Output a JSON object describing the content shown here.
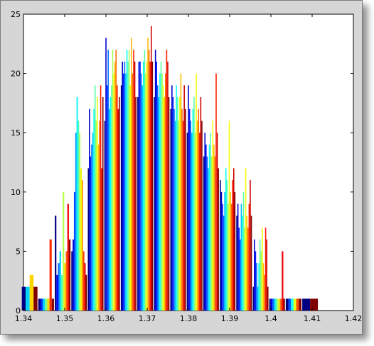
{
  "chart_data": {
    "type": "bar",
    "subtype": "histogram",
    "title": "",
    "xlabel": "",
    "ylabel": "",
    "xlim": [
      1.34,
      1.42
    ],
    "ylim": [
      0,
      25
    ],
    "xticks": [
      "1.34",
      "1.35",
      "1.36",
      "1.37",
      "1.38",
      "1.39",
      "1.4",
      "1.41",
      "1.42"
    ],
    "yticks": [
      "0",
      "5",
      "10",
      "15",
      "20",
      "25"
    ],
    "grid": false,
    "colormap": "jet",
    "colors": [
      "#00008f",
      "#0000ff",
      "#0080ff",
      "#00ffff",
      "#80ff80",
      "#ffff00",
      "#ff8000",
      "#ff0000",
      "#800000"
    ],
    "group_width": 0.0038,
    "groups": [
      {
        "x": 1.3415,
        "values": [
          2,
          2,
          3,
          2
        ]
      },
      {
        "x": 1.3455,
        "values": [
          1,
          1,
          1,
          1,
          1,
          6,
          1
        ]
      },
      {
        "x": 1.3495,
        "values": [
          8,
          3,
          4,
          5,
          3,
          10,
          4,
          5,
          9,
          6
        ]
      },
      {
        "x": 1.3535,
        "values": [
          5,
          6,
          10,
          15,
          18,
          16,
          15,
          12,
          11,
          5,
          4,
          3
        ]
      },
      {
        "x": 1.3575,
        "values": [
          12,
          17,
          13,
          14,
          15,
          17,
          19,
          16,
          18,
          14,
          16,
          19,
          12,
          18
        ]
      },
      {
        "x": 1.3615,
        "values": [
          16,
          23,
          19,
          22,
          17,
          18,
          19,
          22,
          20,
          21,
          22,
          19,
          17,
          18
        ]
      },
      {
        "x": 1.3655,
        "values": [
          19,
          21,
          20,
          21,
          20,
          22,
          21,
          22,
          19,
          23,
          20,
          22,
          21,
          18
        ]
      },
      {
        "x": 1.3695,
        "values": [
          18,
          21,
          21,
          20,
          19,
          21,
          22,
          20,
          21,
          23,
          22,
          21,
          24,
          21
        ]
      },
      {
        "x": 1.3735,
        "values": [
          18,
          22,
          21,
          19,
          18,
          20,
          21,
          20,
          19,
          18,
          20,
          22,
          21,
          18
        ]
      },
      {
        "x": 1.3775,
        "values": [
          17,
          19,
          18,
          17,
          16,
          19,
          18,
          16,
          18,
          20,
          17,
          16,
          19,
          17
        ]
      },
      {
        "x": 1.3815,
        "values": [
          15,
          19,
          17,
          16,
          15,
          17,
          18,
          15,
          20,
          16,
          17,
          15,
          18,
          16
        ]
      },
      {
        "x": 1.3855,
        "values": [
          13,
          15,
          14,
          13,
          12,
          14,
          15,
          13,
          16,
          14,
          13,
          20,
          15,
          12
        ]
      },
      {
        "x": 1.3895,
        "values": [
          11,
          10,
          9,
          8,
          10,
          12,
          11,
          9,
          16,
          10,
          9,
          11,
          12,
          10
        ]
      },
      {
        "x": 1.3935,
        "values": [
          8,
          9,
          7,
          6,
          9,
          8,
          10,
          7,
          12,
          8,
          7,
          9,
          11,
          8
        ]
      },
      {
        "x": 1.3975,
        "values": [
          2,
          6,
          5,
          4,
          2,
          4,
          6,
          5,
          7,
          4,
          3,
          7,
          6,
          2
        ]
      },
      {
        "x": 1.4015,
        "values": [
          1,
          1,
          1,
          1,
          1,
          1,
          1,
          1,
          5,
          1
        ]
      },
      {
        "x": 1.4055,
        "values": [
          1,
          1,
          1,
          1,
          1,
          1
        ]
      },
      {
        "x": 1.4095,
        "values": [
          1,
          1
        ]
      }
    ]
  }
}
